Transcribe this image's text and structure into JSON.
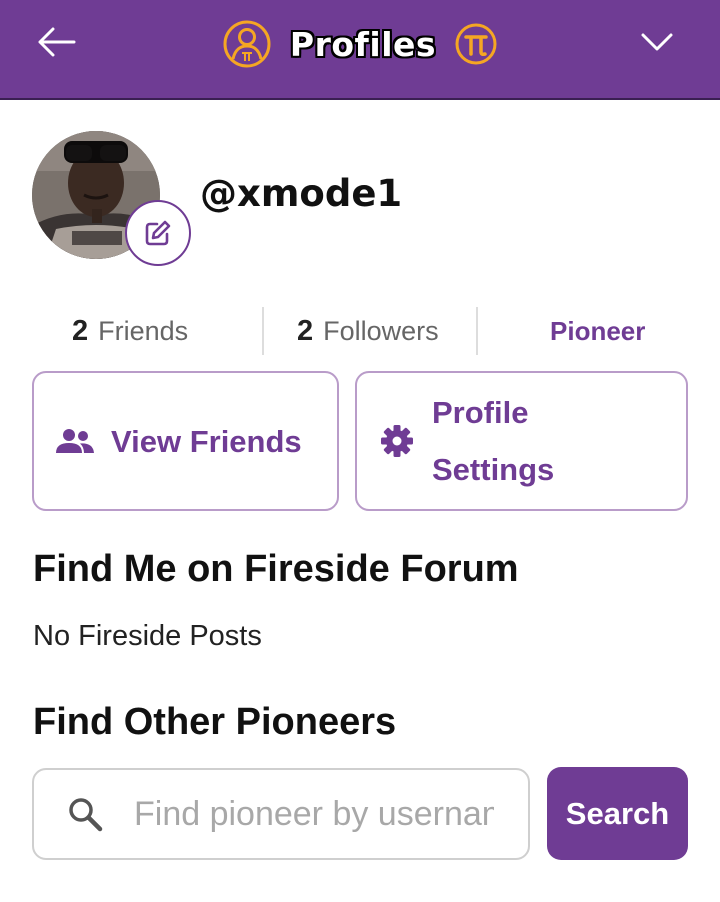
{
  "header": {
    "title": "Profiles",
    "back_icon": "arrow-left-icon",
    "menu_icon": "chevron-down-icon",
    "brand_color": "#6f3c94",
    "accent_color": "#f5a623"
  },
  "profile": {
    "username": "@xmode1",
    "avatar_icon": "user-avatar-photo",
    "edit_icon": "edit-pencil-icon"
  },
  "stats": {
    "friends_count": "2",
    "friends_label": "Friends",
    "followers_count": "2",
    "followers_label": "Followers",
    "role": "Pioneer"
  },
  "actions": {
    "view_friends": "View Friends",
    "profile_settings_line1": "Profile",
    "profile_settings_line2": "Settings"
  },
  "fireside": {
    "heading": "Find Me on Fireside Forum",
    "empty_text": "No Fireside Posts"
  },
  "find_pioneers": {
    "heading": "Find Other Pioneers",
    "placeholder": "Find pioneer by username",
    "button_label": "Search"
  }
}
